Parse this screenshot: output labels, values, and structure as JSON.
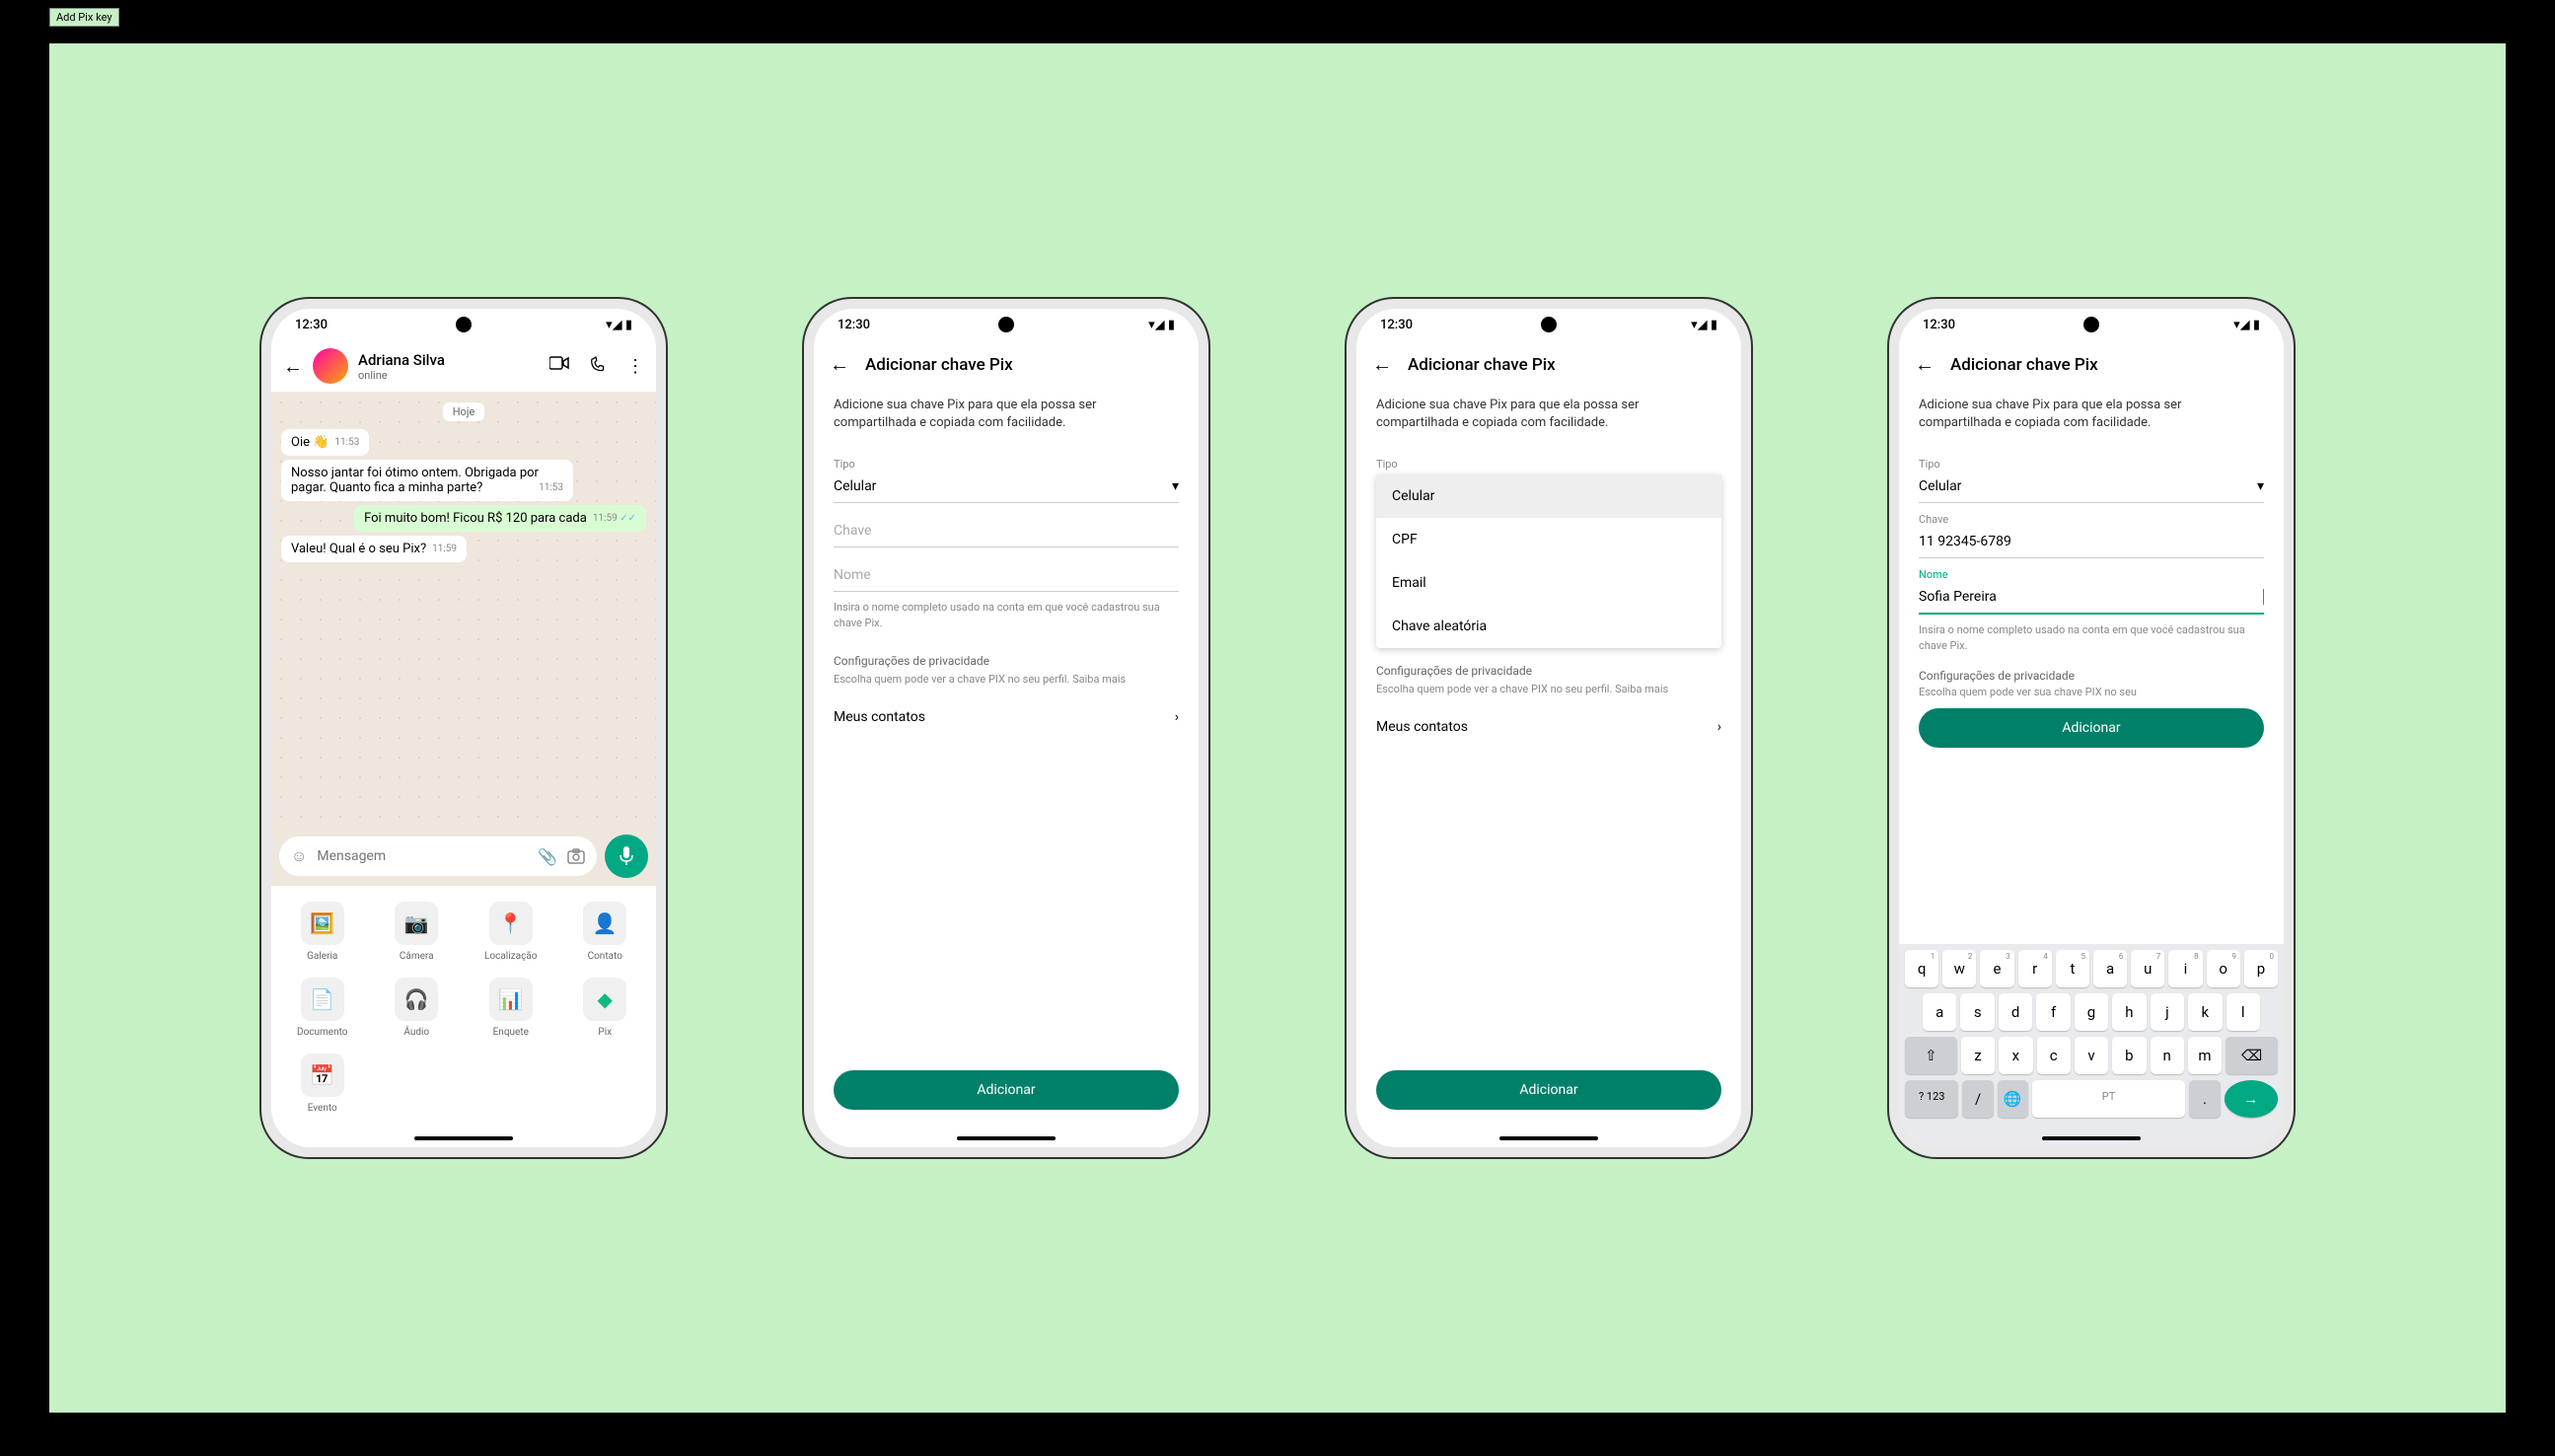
{
  "tooltip": "Add Pix key",
  "status_time": "12:30",
  "phone1": {
    "contact_name": "Adriana Silva",
    "contact_status": "online",
    "date_chip": "Hoje",
    "msg1": "Oie 👋",
    "msg1_time": "11:53",
    "msg2": "Nosso jantar foi ótimo ontem. Obrigada por pagar. Quanto fica a minha parte?",
    "msg2_time": "11:53",
    "msg3": "Foi muito bom! Ficou R$ 120 para cada",
    "msg3_time": "11:59",
    "msg4": "Valeu! Qual é o seu Pix?",
    "msg4_time": "11:59",
    "input_placeholder": "Mensagem",
    "attach": {
      "gallery": "Galeria",
      "camera": "Câmera",
      "location": "Localização",
      "contact": "Contato",
      "document": "Documento",
      "audio": "Áudio",
      "poll": "Enquete",
      "pix": "Pix",
      "event": "Evento"
    }
  },
  "form": {
    "title": "Adicionar chave Pix",
    "desc": "Adicione sua chave Pix para que ela possa ser compartilhada e copiada com facilidade.",
    "tipo_label": "Tipo",
    "tipo_value": "Celular",
    "chave_label": "Chave",
    "nome_label": "Nome",
    "helper": "Insira o nome completo usado na conta em que você cadastrou sua chave Pix.",
    "privacy_title": "Configurações de privacidade",
    "privacy_desc": "Escolha quem pode ver a chave PIX no seu perfil. Saiba mais",
    "privacy_desc_cut": "Escolha quem pode ver sua chave PIX no seu",
    "contacts": "Meus contatos",
    "add_btn": "Adicionar",
    "dropdown": {
      "celular": "Celular",
      "cpf": "CPF",
      "email": "Email",
      "random": "Chave aleatória"
    },
    "chave_value": "11 92345-6789",
    "nome_value": "Sofia Pereira"
  },
  "keyboard": {
    "row1": [
      "q",
      "w",
      "e",
      "r",
      "t",
      "a",
      "u",
      "i",
      "o",
      "p"
    ],
    "row1_nums": [
      "1",
      "2",
      "3",
      "4",
      "5",
      "6",
      "7",
      "8",
      "9",
      "0"
    ],
    "row2": [
      "a",
      "s",
      "d",
      "f",
      "g",
      "h",
      "j",
      "k",
      "l"
    ],
    "row3": [
      "z",
      "x",
      "c",
      "v",
      "b",
      "n",
      "m"
    ],
    "numkey": "? 123",
    "lang": "PT"
  }
}
